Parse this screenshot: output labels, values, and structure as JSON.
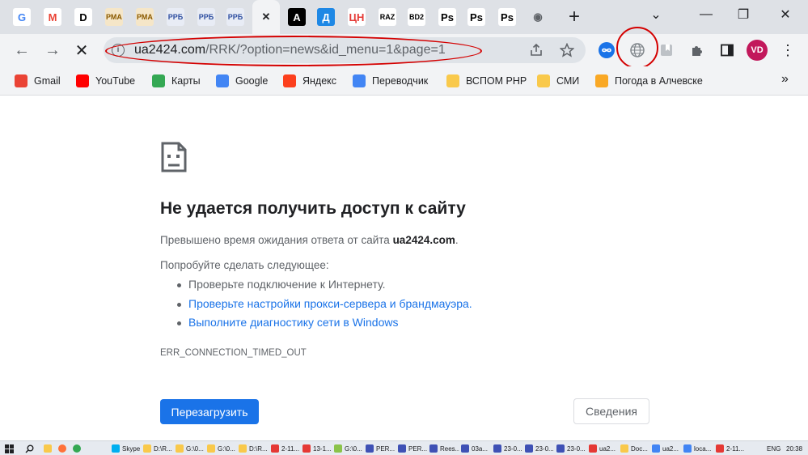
{
  "tabs": [
    {
      "icon": "google-icon",
      "glyph": "G",
      "bg": "#ffffff",
      "fg": "#4285f4"
    },
    {
      "icon": "gmail-icon",
      "glyph": "M",
      "bg": "#ffffff",
      "fg": "#ea4335"
    },
    {
      "icon": "d-site-icon",
      "glyph": "D",
      "bg": "#ffffff",
      "fg": "#000000"
    },
    {
      "icon": "rma-icon",
      "glyph": "РМА",
      "bg": "#f5e6c8",
      "fg": "#8a5a00"
    },
    {
      "icon": "rma-icon",
      "glyph": "РМА",
      "bg": "#f5e6c8",
      "fg": "#8a5a00"
    },
    {
      "icon": "rrb-icon",
      "glyph": "РРБ",
      "bg": "#e8ecf5",
      "fg": "#2f4fa0"
    },
    {
      "icon": "rrb-icon",
      "glyph": "РРБ",
      "bg": "#e8ecf5",
      "fg": "#2f4fa0"
    },
    {
      "icon": "rrb-icon",
      "glyph": "РРБ",
      "bg": "#e8ecf5",
      "fg": "#2f4fa0"
    },
    {
      "icon": "close-icon",
      "glyph": "✕",
      "bg": "transparent",
      "fg": "#202124"
    },
    {
      "icon": "a-site-icon",
      "glyph": "A",
      "bg": "#000000",
      "fg": "#ffffff"
    },
    {
      "icon": "d-blue-icon",
      "glyph": "Д",
      "bg": "#1e88e5",
      "fg": "#ffffff"
    },
    {
      "icon": "tsn-icon",
      "glyph": "ЦН",
      "bg": "#ffffff",
      "fg": "#e53935"
    },
    {
      "icon": "raz-icon",
      "glyph": "RAZ",
      "bg": "#ffffff",
      "fg": "#000000"
    },
    {
      "icon": "bd2-icon",
      "glyph": "BD2",
      "bg": "#ffffff",
      "fg": "#000000"
    },
    {
      "icon": "ps-icon",
      "glyph": "Ps",
      "bg": "#ffffff",
      "fg": "#000000"
    },
    {
      "icon": "ps-icon",
      "glyph": "Ps",
      "bg": "#ffffff",
      "fg": "#000000"
    },
    {
      "icon": "ps-icon",
      "glyph": "Ps",
      "bg": "#ffffff",
      "fg": "#000000"
    },
    {
      "icon": "globe-icon",
      "glyph": "◉",
      "bg": "transparent",
      "fg": "#5f6368"
    }
  ],
  "window": {
    "new_tab": "+",
    "dropdown": "⌄",
    "minimize": "—",
    "restore": "❐",
    "close": "✕"
  },
  "address": {
    "host": "ua2424.com",
    "path": "/RRK/?option=news&id_menu=1&page=1",
    "info": "i"
  },
  "nav": {
    "back": "←",
    "forward": "→",
    "stop": "✕"
  },
  "profile": {
    "initials": "VD",
    "color": "#c2185b"
  },
  "bookmarks": [
    {
      "label": "Gmail",
      "icon": "gmail-icon",
      "color": "#ea4335"
    },
    {
      "label": "YouTube",
      "icon": "youtube-icon",
      "color": "#ff0000"
    },
    {
      "label": "Карты",
      "icon": "maps-icon",
      "color": "#34a853"
    },
    {
      "label": "Google",
      "icon": "google-icon",
      "color": "#4285f4"
    },
    {
      "label": "Яндекс",
      "icon": "yandex-icon",
      "color": "#fc3f1d"
    },
    {
      "label": "Переводчик",
      "icon": "translate-icon",
      "color": "#4285f4"
    },
    {
      "label": "ВСПОМ РНР",
      "icon": "folder-icon",
      "color": "#f9c94b"
    },
    {
      "label": "СМИ",
      "icon": "folder-icon",
      "color": "#f9c94b"
    },
    {
      "label": "Погода в Алчевске",
      "icon": "weather-icon",
      "color": "#f9a825"
    }
  ],
  "bookmarks_more": "»",
  "error": {
    "title": "Не удается получить доступ к сайту",
    "desc_prefix": "Превышено время ожидания ответа от сайта ",
    "desc_host": "ua2424.com",
    "desc_suffix": ".",
    "try_label": "Попробуйте сделать следующее:",
    "suggestions": [
      {
        "text": "Проверьте подключение к Интернету.",
        "link": false
      },
      {
        "text": "Проверьте настройки прокси-сервера и брандмауэра.",
        "link": true
      },
      {
        "text": "Выполните диагностику сети в Windows",
        "link": true
      }
    ],
    "code": "ERR_CONNECTION_TIMED_OUT",
    "reload": "Перезагрузить",
    "details": "Сведения"
  },
  "taskbar": {
    "items": [
      {
        "label": "Skype",
        "color": "#00aff0"
      },
      {
        "label": "D:\\R...",
        "color": "#f9c94b"
      },
      {
        "label": "G:\\0...",
        "color": "#f9c94b"
      },
      {
        "label": "G:\\0...",
        "color": "#f9c94b"
      },
      {
        "label": "D:\\R...",
        "color": "#f9c94b"
      },
      {
        "label": "2-11...",
        "color": "#e53935"
      },
      {
        "label": "13-1...",
        "color": "#e53935"
      },
      {
        "label": "G:\\0...",
        "color": "#8bc34a"
      },
      {
        "label": "PER...",
        "color": "#3f51b5"
      },
      {
        "label": "PER...",
        "color": "#3f51b5"
      },
      {
        "label": "Rees...",
        "color": "#3f51b5"
      },
      {
        "label": "03a...",
        "color": "#3f51b5"
      },
      {
        "label": "23-0...",
        "color": "#3f51b5"
      },
      {
        "label": "23-0...",
        "color": "#3f51b5"
      },
      {
        "label": "23-0...",
        "color": "#3f51b5"
      },
      {
        "label": "ua2...",
        "color": "#e53935"
      },
      {
        "label": "Doc...",
        "color": "#f9c94b"
      },
      {
        "label": "ua2...",
        "color": "#4285f4"
      },
      {
        "label": "loca...",
        "color": "#4285f4"
      },
      {
        "label": "2-11...",
        "color": "#e53935"
      }
    ],
    "lang": "ENG",
    "time": "20:38"
  }
}
